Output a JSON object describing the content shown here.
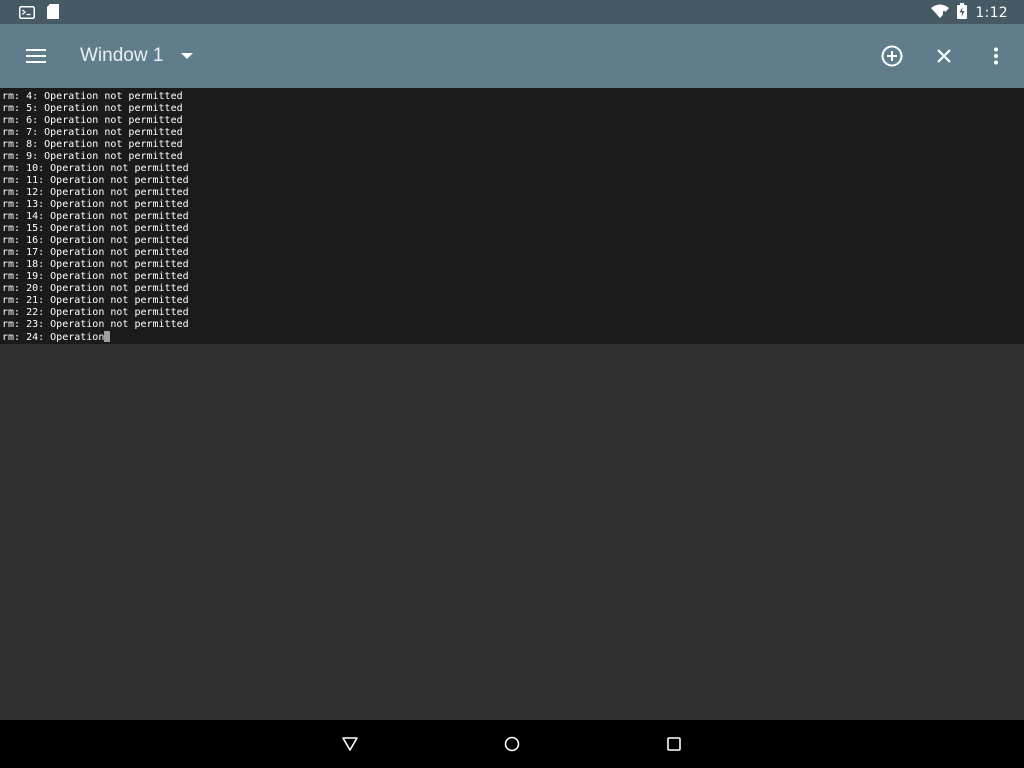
{
  "status_bar": {
    "time": "1:12",
    "left_icons": [
      "terminal-notification-icon",
      "sd-card-icon"
    ],
    "right_icons": [
      "wifi-icon",
      "battery-charging-icon"
    ]
  },
  "app_bar": {
    "menu_icon": "hamburger-menu-icon",
    "window_title": "Window 1",
    "dropdown_icon": "dropdown-arrow-icon",
    "actions": [
      "add-window-icon",
      "close-window-icon",
      "overflow-menu-icon"
    ]
  },
  "terminal": {
    "lines": [
      "rm: 4: Operation not permitted",
      "rm: 5: Operation not permitted",
      "rm: 6: Operation not permitted",
      "rm: 7: Operation not permitted",
      "rm: 8: Operation not permitted",
      "rm: 9: Operation not permitted",
      "rm: 10: Operation not permitted",
      "rm: 11: Operation not permitted",
      "rm: 12: Operation not permitted",
      "rm: 13: Operation not permitted",
      "rm: 14: Operation not permitted",
      "rm: 15: Operation not permitted",
      "rm: 16: Operation not permitted",
      "rm: 17: Operation not permitted",
      "rm: 18: Operation not permitted",
      "rm: 19: Operation not permitted",
      "rm: 20: Operation not permitted",
      "rm: 21: Operation not permitted",
      "rm: 22: Operation not permitted",
      "rm: 23: Operation not permitted",
      "rm: 24: Operation"
    ]
  },
  "nav_bar": {
    "buttons": [
      "back-icon",
      "home-icon",
      "recents-icon"
    ]
  }
}
